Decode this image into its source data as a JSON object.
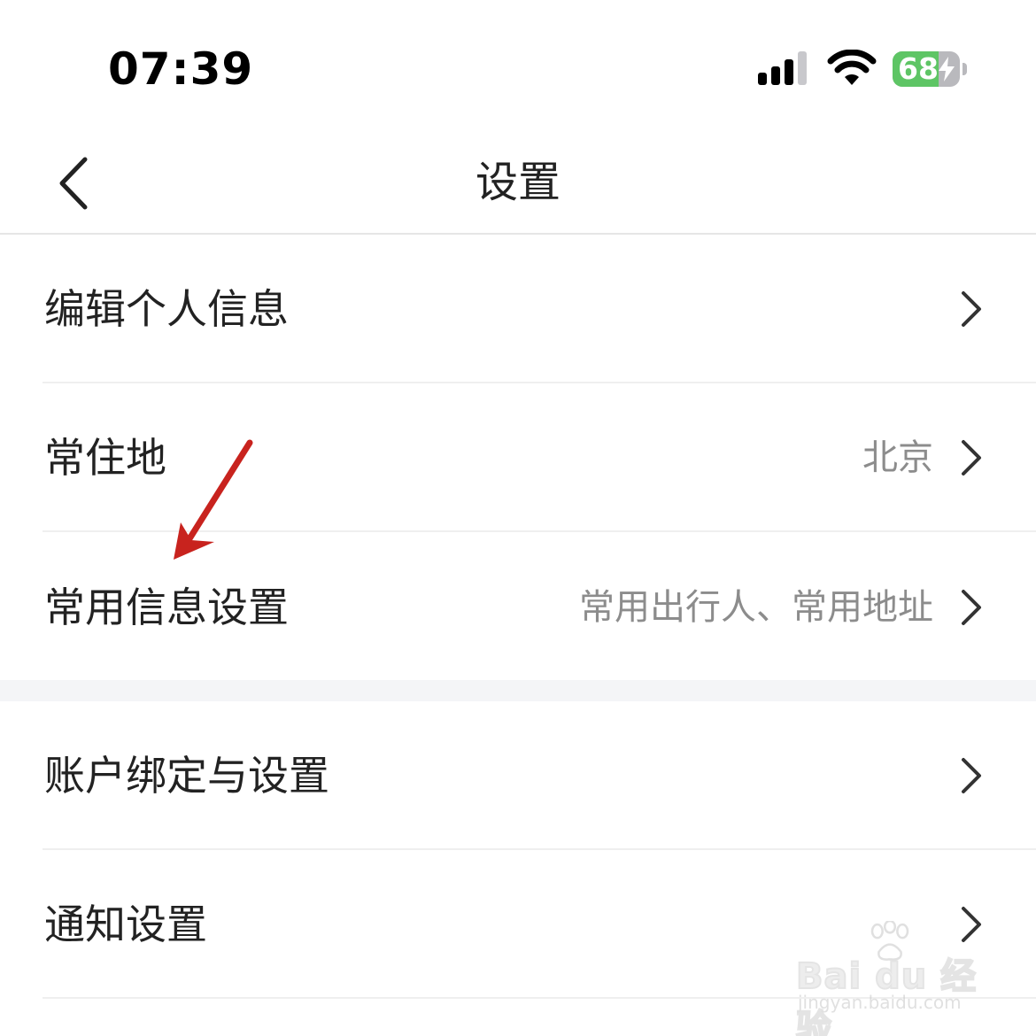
{
  "status_bar": {
    "time": "07:39",
    "signal_icon": "cellular-signal-icon",
    "wifi_icon": "wifi-icon",
    "battery": {
      "level": "68",
      "level_fraction": 0.68,
      "charging": true,
      "fill_color": "#5ec565"
    }
  },
  "nav": {
    "back_icon": "chevron-left-icon",
    "title": "设置"
  },
  "groups": [
    {
      "rows": [
        {
          "label": "编辑个人信息",
          "value": ""
        },
        {
          "label": "常住地",
          "value": "北京"
        },
        {
          "label": "常用信息设置",
          "value": "常用出行人、常用地址"
        }
      ]
    },
    {
      "rows": [
        {
          "label": "账户绑定与设置",
          "value": ""
        },
        {
          "label": "通知设置",
          "value": ""
        }
      ]
    }
  ],
  "annotation": {
    "icon": "red-arrow-icon",
    "color": "#c8231e"
  },
  "watermark": {
    "brand": "Bai du 经验",
    "url": "jingyan.baidu.com"
  }
}
